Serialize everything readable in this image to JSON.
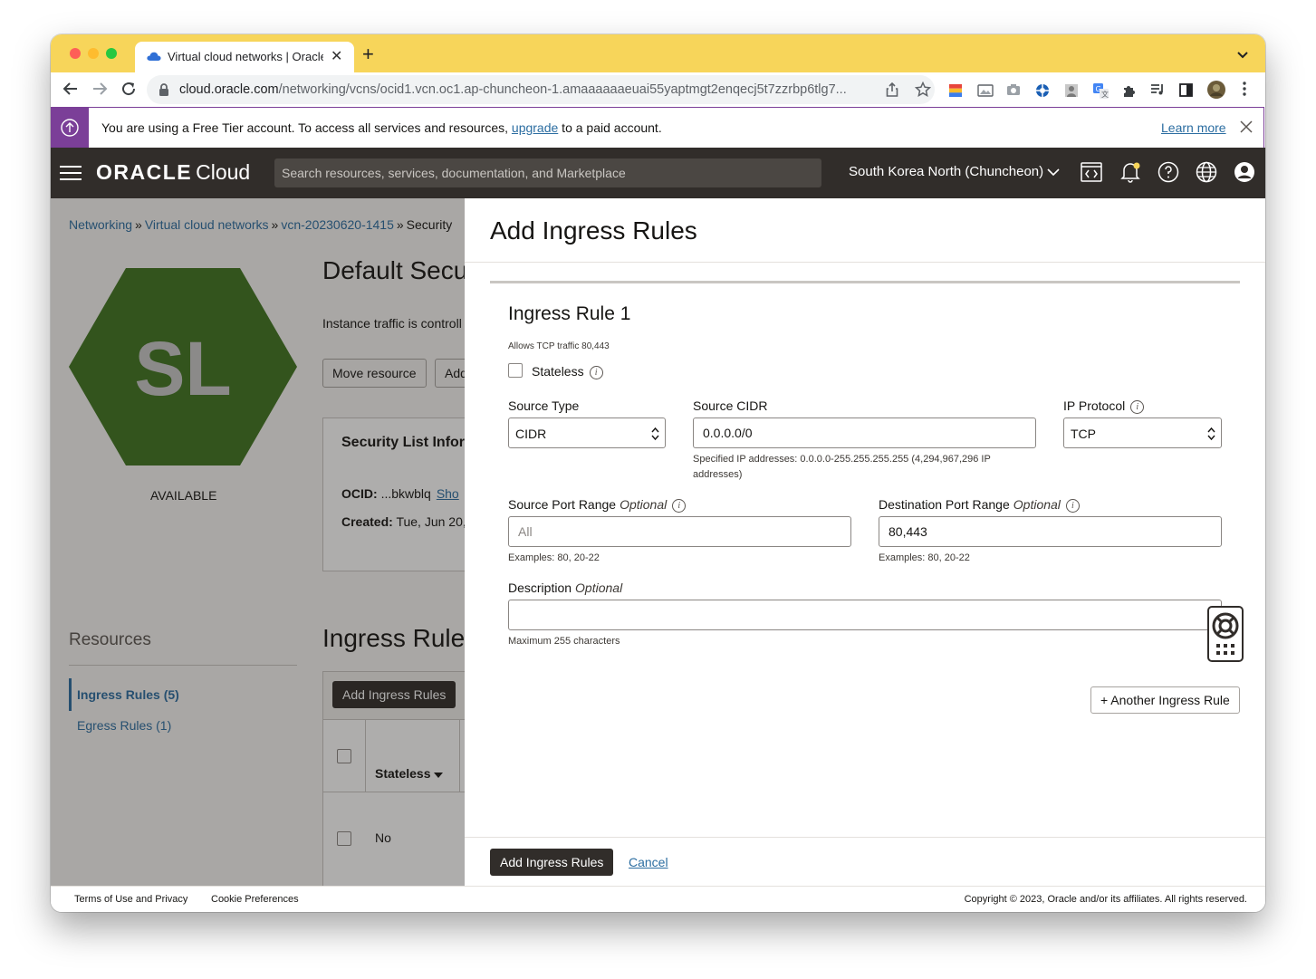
{
  "browser": {
    "tab_title": "Virtual cloud networks | Oracle",
    "url_host": "cloud.oracle.com",
    "url_path": "/networking/vcns/ocid1.vcn.oc1.ap-chuncheon-1.amaaaaaaeuai55yaptmgt2enqecj5t7zzrbp6tlg7..."
  },
  "banner": {
    "text_before": "You are using a Free Tier account. To access all services and resources, ",
    "link": "upgrade",
    "text_after": " to a paid account.",
    "learn_more": "Learn more",
    "accent": "#7b3f98"
  },
  "header": {
    "logo_oracle": "ORACLE",
    "logo_cloud": "Cloud",
    "search_placeholder": "Search resources, services, documentation, and Marketplace",
    "region": "South Korea North (Chuncheon)"
  },
  "page": {
    "breadcrumb": [
      "Networking",
      "Virtual cloud networks",
      "vcn-20230620-1415",
      "Security"
    ],
    "hex_initials": "SL",
    "status": "AVAILABLE",
    "title": "Default Secu",
    "description": "Instance traffic is controll",
    "buttons": [
      "Move resource",
      "Add"
    ],
    "info_title": "Security List Inforr",
    "ocid_label": "OCID:",
    "ocid_value": "...bkwblq",
    "ocid_show": "Sho",
    "created_label": "Created:",
    "created_value": "Tue, Jun 20,",
    "resources_title": "Resources",
    "resources": [
      {
        "label": "Ingress Rules (5)"
      },
      {
        "label": "Egress Rules (1)"
      }
    ],
    "ingress_title": "Ingress Rule",
    "table_add": "Add Ingress Rules",
    "col_stateless": "Stateless",
    "row_stateless": "No"
  },
  "panel": {
    "title": "Add Ingress Rules",
    "rule_title": "Ingress Rule 1",
    "rule_summary": "Allows TCP traffic 80,443",
    "stateless_label": "Stateless",
    "source_type_label": "Source Type",
    "source_type_value": "CIDR",
    "source_cidr_label": "Source CIDR",
    "source_cidr_value": "0.0.0.0/0",
    "source_cidr_help": "Specified IP addresses: 0.0.0.0-255.255.255.255 (4,294,967,296 IP addresses)",
    "ip_protocol_label": "IP Protocol",
    "ip_protocol_value": "TCP",
    "src_port_label": "Source Port Range",
    "optional": "Optional",
    "src_port_placeholder": "All",
    "src_port_help": "Examples: 80, 20-22",
    "dst_port_label": "Destination Port Range",
    "dst_port_value": "80,443",
    "dst_port_help": "Examples: 80, 20-22",
    "description_label": "Description",
    "description_help": "Maximum 255 characters",
    "another_rule": "+ Another Ingress Rule",
    "submit": "Add Ingress Rules",
    "cancel": "Cancel"
  },
  "footer": {
    "terms": "Terms of Use and Privacy",
    "cookies": "Cookie Preferences",
    "copyright": "Copyright © 2023, Oracle and/or its affiliates. All rights reserved."
  }
}
